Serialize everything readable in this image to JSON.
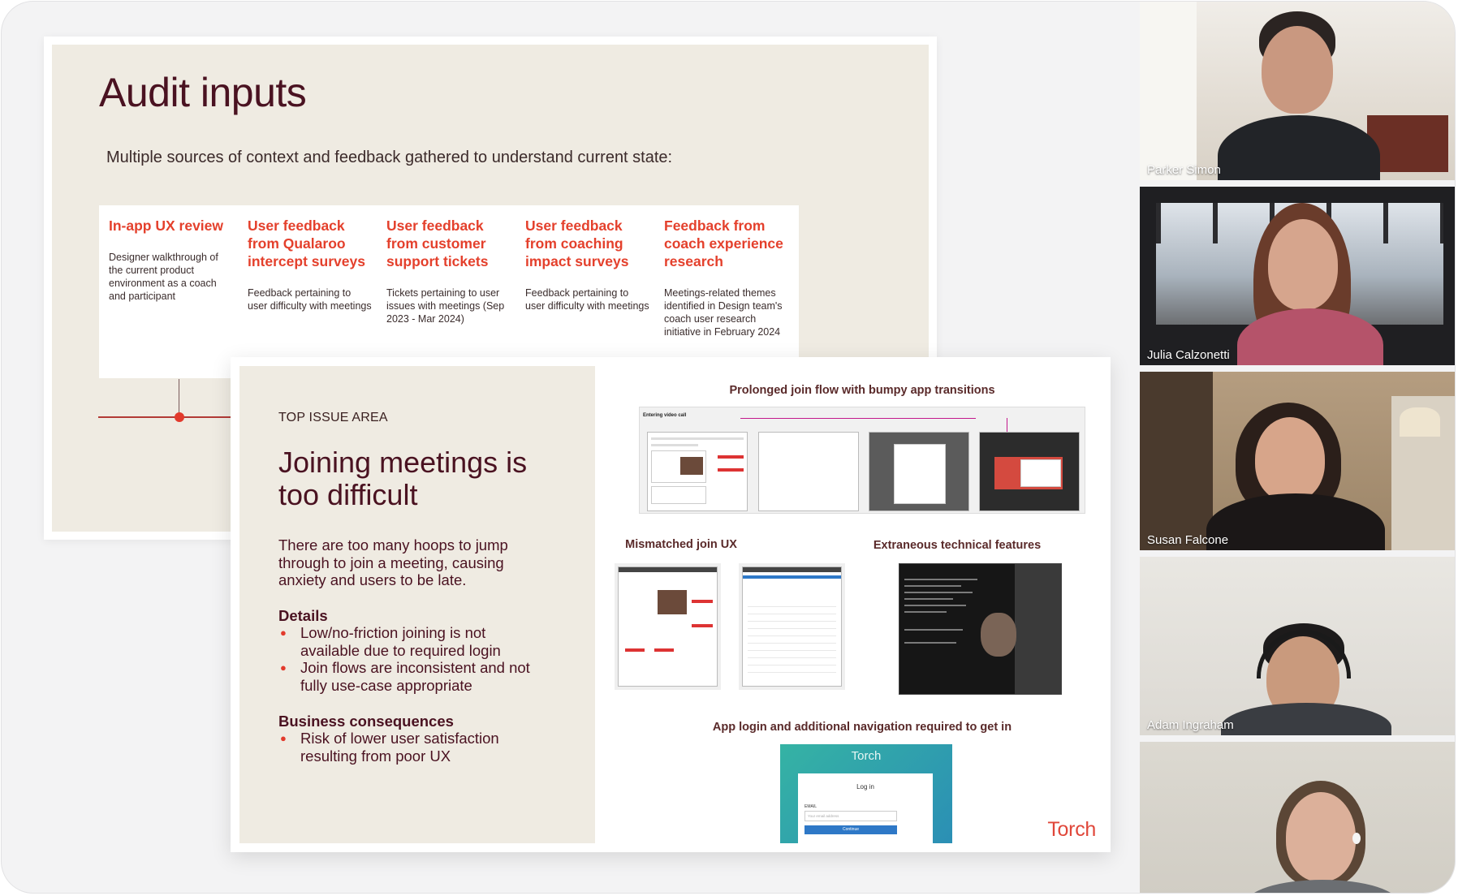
{
  "slide1": {
    "title": "Audit inputs",
    "subtitle": "Multiple sources of context and feedback gathered to understand current state:",
    "cards": [
      {
        "title": "In-app UX review",
        "body": "Designer walkthrough of the current product environment as a coach and participant"
      },
      {
        "title": "User feedback from Qualaroo intercept surveys",
        "body": "Feedback pertaining to user difficulty with meetings"
      },
      {
        "title": "User feedback from customer support tickets",
        "body": "Tickets pertaining to user issues with meetings (Sep 2023 - Mar 2024)"
      },
      {
        "title": "User feedback from coaching impact surveys",
        "body": "Feedback pertaining to user difficulty with meetings"
      },
      {
        "title": "Feedback from coach experience research",
        "body": "Meetings-related themes identified in Design team's coach user research initiative in February 2024"
      }
    ]
  },
  "slide2": {
    "eyebrow": "TOP ISSUE AREA",
    "title": "Joining meetings is too difficult",
    "body": "There are too many hoops to jump through to join a meeting, causing anxiety and users to be late.",
    "details_heading": "Details",
    "details": [
      "Low/no-friction joining is not available due to required login",
      "Join flows are inconsistent and not fully use-case appropriate"
    ],
    "consequences_heading": "Business consequences",
    "consequences": [
      "Risk of lower user satisfaction resulting from poor UX"
    ],
    "captions": {
      "flow": "Prolonged join flow with bumpy app transitions",
      "mismatch": "Mismatched join UX",
      "technical": "Extraneous technical features",
      "login": "App login and additional navigation required to get in"
    },
    "thumb_label": "Entering video call",
    "login": {
      "brand": "Torch",
      "heading": "Log in",
      "email_label": "EMAIL",
      "email_placeholder": "Your email address",
      "button": "Continue"
    },
    "brand": "Torch"
  },
  "participants": [
    {
      "name": "Parker Simon"
    },
    {
      "name": "Julia Calzonetti"
    },
    {
      "name": "Susan Falcone"
    },
    {
      "name": "Adam Ingraham"
    },
    {
      "name": ""
    }
  ]
}
